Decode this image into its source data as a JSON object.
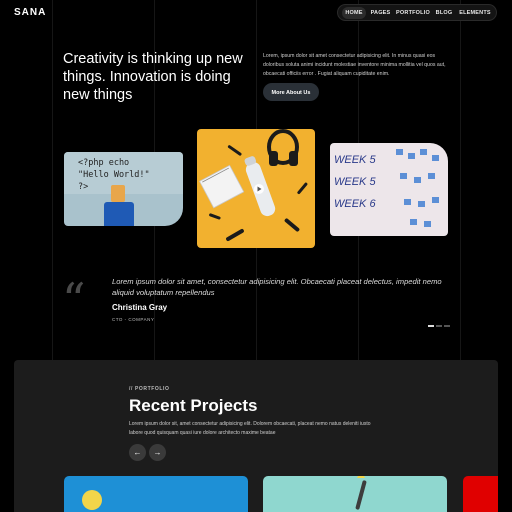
{
  "brand": {
    "logo_text": "SANA"
  },
  "nav": {
    "items": [
      {
        "label": "HOME",
        "active": true
      },
      {
        "label": "PAGES",
        "active": false
      },
      {
        "label": "PORTFOLIO",
        "active": false
      },
      {
        "label": "BLOG",
        "active": false
      },
      {
        "label": "ELEMENTS",
        "active": false
      }
    ]
  },
  "hero": {
    "headline": "Creativity is thinking up new things. Innovation is doing new things",
    "intro": "Lorem, ipsum dolor sit amet consectetur adipisicing elit. In minus quasi eos doloribus soluta animi incidunt molestiae inventore minima mollitia vel quos aut, obcaecati officiis error . Fugiat aliquam cupiditate enim.",
    "button_label": "More About Us"
  },
  "gallery": {
    "card1_code_line1": "<?php echo",
    "card1_code_line2": "\"Hello World!\"",
    "card1_code_line3": "?>",
    "card3_text": "WEEK 5 WEEK 5 WEEK 6"
  },
  "testimonial": {
    "quote_mark": "“",
    "text": "Lorem ipsum dolor sit amet, consectetur adipisicing elit. Obcaecati placeat delectus, impedit nemo aliquid voluptatum repellendus",
    "author": "Christina Gray",
    "role": "CTO - COMPANY"
  },
  "portfolio": {
    "eyebrow": "// PORTFOLIO",
    "title": "Recent Projects",
    "description": "Lorem ipsum dolor sit, amet consectetur adipisicing elit. Dolorem obcaecati, placeat nemo natus deleniti iusto labore quod quisquam quasi iure dolore architecto maxime beatae",
    "prev_symbol": "←",
    "next_symbol": "→"
  },
  "colors": {
    "background": "#000000",
    "section_bg": "#1c1c1c",
    "button_bg": "#2a3037",
    "accent_yellow": "#f2b12f",
    "accent_blue": "#1e90d6",
    "accent_red": "#e00000"
  }
}
